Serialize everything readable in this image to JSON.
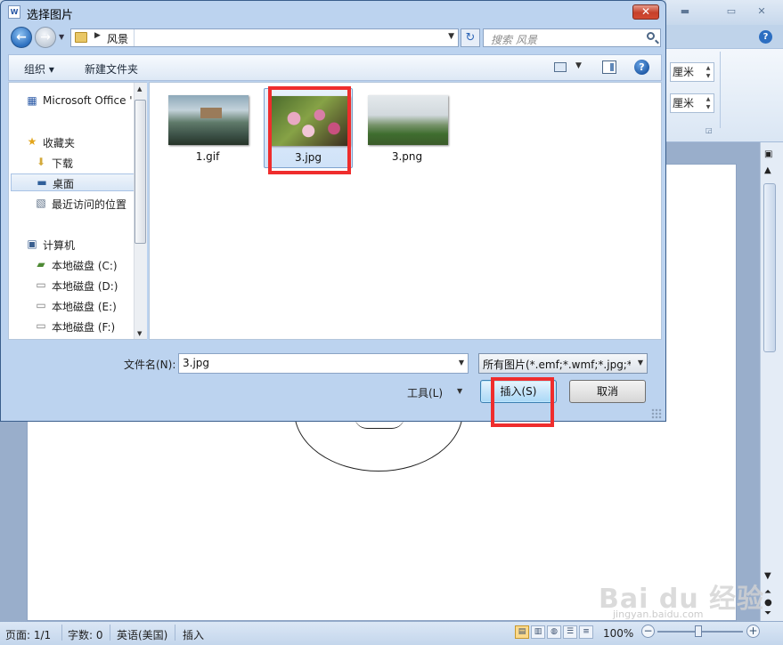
{
  "dialog": {
    "title": "选择图片",
    "nav": {
      "address_crumb": "风景",
      "search_placeholder": "搜索 风景"
    },
    "toolbar": {
      "organize_label": "组织 ▾",
      "new_folder_label": "新建文件夹"
    },
    "tree": [
      {
        "label": "Microsoft Office '",
        "icon": "word-document-icon"
      },
      {
        "label": "收藏夹",
        "icon": "star-icon"
      },
      {
        "label": "下载",
        "icon": "download-folder-icon"
      },
      {
        "label": "桌面",
        "icon": "desktop-icon"
      },
      {
        "label": "最近访问的位置",
        "icon": "recent-places-icon"
      },
      {
        "label": "计算机",
        "icon": "computer-icon"
      },
      {
        "label": "本地磁盘 (C:)",
        "icon": "system-drive-icon"
      },
      {
        "label": "本地磁盘 (D:)",
        "icon": "drive-icon"
      },
      {
        "label": "本地磁盘 (E:)",
        "icon": "drive-icon"
      },
      {
        "label": "本地磁盘 (F:)",
        "icon": "drive-icon"
      }
    ],
    "files": [
      {
        "name": "1.gif"
      },
      {
        "name": "3.jpg"
      },
      {
        "name": "3.png"
      }
    ],
    "filename_label": "文件名(N):",
    "filename_value": "3.jpg",
    "filter_value": "所有图片(*.emf;*.wmf;*.jpg;*.jp",
    "tools_label": "工具(L)",
    "insert_label": "插入(S)",
    "cancel_label": "取消"
  },
  "word": {
    "ribbon_unit_1": "厘米",
    "ribbon_unit_2": "厘米",
    "status": {
      "page": "页面: 1/1",
      "words": "字数: 0",
      "language": "英语(美国)",
      "mode": "插入",
      "zoom": "100%"
    }
  },
  "watermark": {
    "text": "Bai du 经验",
    "sub": "jingyan.baidu.com"
  },
  "colors": {
    "highlight": "#ef2d2d",
    "selection": "#cfe2f8",
    "accent": "#2c6fbf"
  }
}
